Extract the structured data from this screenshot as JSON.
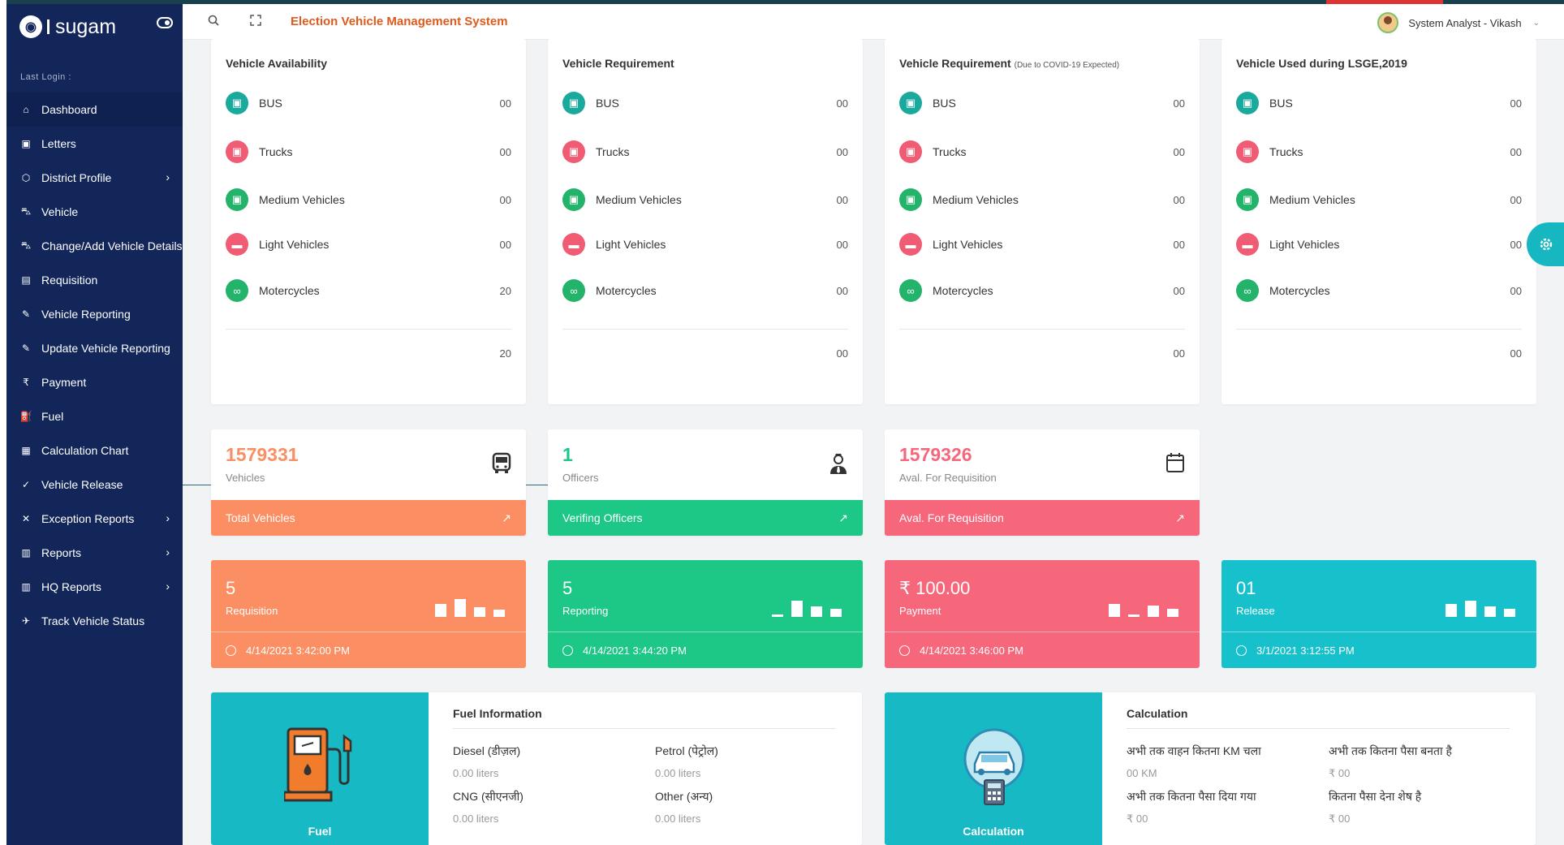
{
  "app": {
    "logo_text": "sugam",
    "title": "Election Vehicle Management System"
  },
  "user": {
    "name": "System Analyst - Vikash"
  },
  "sidebar": {
    "last_login": "Last Login :",
    "items": [
      {
        "label": "Dashboard",
        "icon": "home-icon",
        "glyph": "⌂",
        "chev": false
      },
      {
        "label": "Letters",
        "icon": "letters-icon",
        "glyph": "▣",
        "chev": false
      },
      {
        "label": "District Profile",
        "icon": "box-icon",
        "glyph": "⬡",
        "chev": true
      },
      {
        "label": "Vehicle",
        "icon": "car-icon",
        "glyph": "⛍",
        "chev": false
      },
      {
        "label": "Change/Add Vehicle Details",
        "icon": "car-edit-icon",
        "glyph": "⛍",
        "chev": false
      },
      {
        "label": "Requisition",
        "icon": "document-icon",
        "glyph": "▤",
        "chev": false
      },
      {
        "label": "Vehicle Reporting",
        "icon": "reporting-icon",
        "glyph": "✎",
        "chev": false
      },
      {
        "label": "Update Vehicle Reporting",
        "icon": "update-reporting-icon",
        "glyph": "✎",
        "chev": false
      },
      {
        "label": "Payment",
        "icon": "rupee-icon",
        "glyph": "₹",
        "chev": false
      },
      {
        "label": "Fuel",
        "icon": "fuel-icon",
        "glyph": "⛽",
        "chev": false
      },
      {
        "label": "Calculation Chart",
        "icon": "calculator-icon",
        "glyph": "▦",
        "chev": false
      },
      {
        "label": "Vehicle Release",
        "icon": "release-icon",
        "glyph": "✓",
        "chev": false
      },
      {
        "label": "Exception Reports",
        "icon": "exception-icon",
        "glyph": "✕",
        "chev": true
      },
      {
        "label": "Reports",
        "icon": "reports-icon",
        "glyph": "▥",
        "chev": true
      },
      {
        "label": "HQ Reports",
        "icon": "hq-reports-icon",
        "glyph": "▥",
        "chev": true
      },
      {
        "label": "Track Vehicle Status",
        "icon": "track-icon",
        "glyph": "✈",
        "chev": false
      }
    ]
  },
  "vehicle_cards": [
    {
      "title": "Vehicle Availability",
      "note": "",
      "values": [
        "00",
        "00",
        "00",
        "00",
        "20"
      ],
      "total": "20"
    },
    {
      "title": "Vehicle Requirement",
      "note": "",
      "values": [
        "00",
        "00",
        "00",
        "00",
        "00"
      ],
      "total": "00"
    },
    {
      "title": "Vehicle Requirement",
      "note": "(Due to COVID-19 Expected)",
      "values": [
        "00",
        "00",
        "00",
        "00",
        "00"
      ],
      "total": "00"
    },
    {
      "title": "Vehicle Used during LSGE,2019",
      "note": "",
      "values": [
        "00",
        "00",
        "00",
        "00",
        "00"
      ],
      "total": "00"
    }
  ],
  "vehicle_types": [
    {
      "label": "BUS",
      "color": "#1aa99d"
    },
    {
      "label": "Trucks",
      "color": "#ef5c73"
    },
    {
      "label": "Medium Vehicles",
      "color": "#23b36a"
    },
    {
      "label": "Light Vehicles",
      "color": "#ef5c73"
    },
    {
      "label": "Motercycles",
      "color": "#23b36a"
    }
  ],
  "stats": [
    {
      "value": "1579331",
      "label": "Vehicles",
      "footer": "Total Vehicles",
      "color": "#fb8f63"
    },
    {
      "value": "1",
      "label": "Officers",
      "footer": "Verifing Officers",
      "color": "#1dc887"
    },
    {
      "value": "1579326",
      "label": "Aval. For Requisition",
      "footer": "Aval. For Requisition",
      "color": "#f6677b"
    }
  ],
  "kpis": [
    {
      "value": "5",
      "label": "Requisition",
      "time": "4/14/2021 3:42:00 PM"
    },
    {
      "value": "5",
      "label": "Reporting",
      "time": "4/14/2021 3:44:20 PM"
    },
    {
      "value": "₹ 100.00",
      "label": "Payment",
      "time": "4/14/2021 3:46:00 PM"
    },
    {
      "value": "01",
      "label": "Release",
      "time": "3/1/2021 3:12:55 PM"
    }
  ],
  "fuel": {
    "caption": "Fuel",
    "title": "Fuel Information",
    "items": [
      {
        "name": "Diesel (डीज़ल)",
        "value": "0.00  liters"
      },
      {
        "name": "Petrol (पेट्रोल)",
        "value": "0.00  liters"
      },
      {
        "name": "CNG (सीएनजी)",
        "value": "0.00  liters"
      },
      {
        "name": "Other (अन्य)",
        "value": "0.00  liters"
      }
    ]
  },
  "calculation": {
    "caption": "Calculation",
    "title": "Calculation",
    "items": [
      {
        "name": "अभी तक वाहन कितना KM चला",
        "value": "00  KM"
      },
      {
        "name": "अभी तक कितना पैसा बनता है",
        "value": "₹ 00"
      },
      {
        "name": "अभी तक कितना पैसा दिया गया",
        "value": "₹ 00"
      },
      {
        "name": "कितना पैसा देना शेष है",
        "value": "₹ 00"
      }
    ]
  }
}
